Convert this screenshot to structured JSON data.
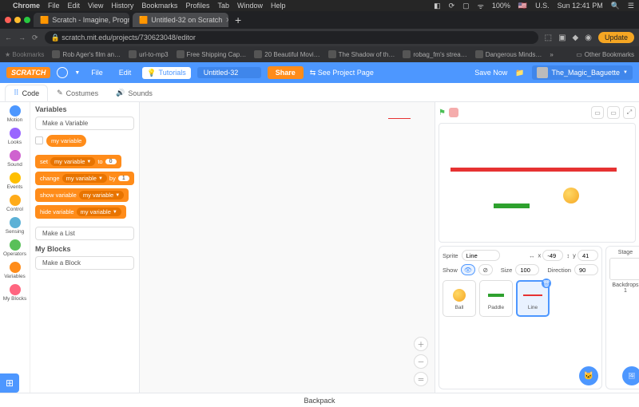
{
  "mac_menu": {
    "app": "Chrome",
    "items": [
      "File",
      "Edit",
      "View",
      "History",
      "Bookmarks",
      "Profiles",
      "Tab",
      "Window",
      "Help"
    ],
    "right": {
      "battery": "100%",
      "locale": "U.S.",
      "clock": "Sun 12:41 PM",
      "flag": "🇺🇸"
    }
  },
  "traffic": {
    "colors": [
      "#ff5f57",
      "#febc2e",
      "#28c840"
    ]
  },
  "chrome_tabs": [
    {
      "label": "Scratch - Imagine, Program, S"
    },
    {
      "label": "Untitled-32 on Scratch"
    }
  ],
  "address_bar": {
    "lock": "🔒",
    "url": "scratch.mit.edu/projects/730623048/editor",
    "update": "Update"
  },
  "bookmarks": {
    "label": "Bookmarks",
    "items": [
      "Rob Ager's film an…",
      "url-to-mp3",
      "Free Shipping Cap…",
      "20 Beautiful Movi…",
      "The Shadow of th…",
      "robag_fm's strea…",
      "Dangerous Minds…"
    ],
    "other": "Other Bookmarks"
  },
  "scratch_bar": {
    "logo": "SCRATCH",
    "file": "File",
    "edit": "Edit",
    "tutorials": "Tutorials",
    "title": "Untitled-32",
    "share": "Share",
    "see": "See Project Page",
    "save": "Save Now",
    "user": "The_Magic_Baguette"
  },
  "editor_tabs": {
    "code": "Code",
    "costumes": "Costumes",
    "sounds": "Sounds"
  },
  "categories": [
    {
      "name": "Motion",
      "color": "#4c97ff"
    },
    {
      "name": "Looks",
      "color": "#9966ff"
    },
    {
      "name": "Sound",
      "color": "#cf63cf"
    },
    {
      "name": "Events",
      "color": "#ffbf00"
    },
    {
      "name": "Control",
      "color": "#ffab19"
    },
    {
      "name": "Sensing",
      "color": "#5cb1d6"
    },
    {
      "name": "Operators",
      "color": "#59c059"
    },
    {
      "name": "Variables",
      "color": "#ff8c1a"
    },
    {
      "name": "My Blocks",
      "color": "#ff6680"
    }
  ],
  "palette": {
    "variables_header": "Variables",
    "make_variable": "Make a Variable",
    "my_variable": "my variable",
    "blocks": {
      "set": {
        "pre": "set",
        "var": "my variable",
        "mid": "to",
        "val": "0"
      },
      "change": {
        "pre": "change",
        "var": "my variable",
        "mid": "by",
        "val": "1"
      },
      "show": {
        "pre": "show variable",
        "var": "my variable"
      },
      "hide": {
        "pre": "hide variable",
        "var": "my variable"
      }
    },
    "make_list": "Make a List",
    "myblocks_header": "My Blocks",
    "make_block": "Make a Block"
  },
  "sprite_info": {
    "sprite_label": "Sprite",
    "name": "Line",
    "x_label": "x",
    "x": "-49",
    "y_label": "y",
    "y": "41",
    "show_label": "Show",
    "size_label": "Size",
    "size": "100",
    "direction_label": "Direction",
    "direction": "90"
  },
  "sprites": [
    {
      "name": "Ball",
      "kind": "ball"
    },
    {
      "name": "Paddle",
      "kind": "paddle"
    },
    {
      "name": "Line",
      "kind": "line"
    }
  ],
  "stage_panel": {
    "stage_label": "Stage",
    "backdrops_label": "Backdrops",
    "backdrops_count": "1"
  },
  "backpack_label": "Backpack"
}
